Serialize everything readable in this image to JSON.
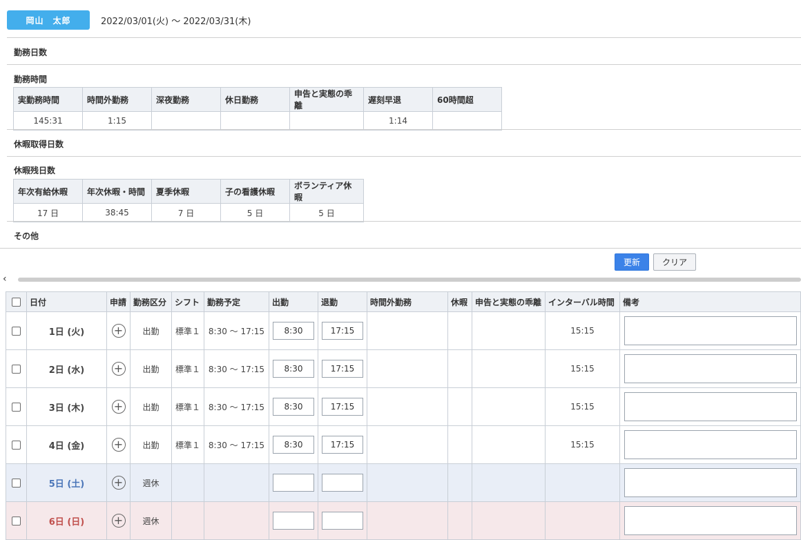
{
  "header": {
    "employee_name": "岡山　太郎",
    "period": "2022/03/01(火) ～ 2022/03/31(木)"
  },
  "sections": {
    "work_days": "勤務日数",
    "work_hours": "勤務時間",
    "leave_taken": "休暇取得日数",
    "leave_remaining": "休暇残日数",
    "other": "その他"
  },
  "work_hours_table": {
    "headers": [
      "実勤務時間",
      "時間外勤務",
      "深夜勤務",
      "休日勤務",
      "申告と実態の乖離",
      "遅刻早退",
      "60時間超"
    ],
    "values": [
      "145:31",
      "1:15",
      "",
      "",
      "",
      "1:14",
      ""
    ]
  },
  "leave_remaining_table": {
    "headers": [
      "年次有給休暇",
      "年次休暇・時間",
      "夏季休暇",
      "子の看護休暇",
      "ボランティア休暇"
    ],
    "values": [
      "17 日",
      "38:45",
      "7 日",
      "5 日",
      "5 日"
    ]
  },
  "buttons": {
    "update": "更新",
    "clear": "クリア"
  },
  "daily_table": {
    "headers": {
      "date": "日付",
      "application": "申請",
      "work_type": "勤務区分",
      "shift": "シフト",
      "planned": "勤務予定",
      "clock_in": "出勤",
      "clock_out": "退勤",
      "overtime": "時間外勤務",
      "leave": "休暇",
      "discrepancy": "申告と実態の乖離",
      "interval": "インターバル時間",
      "remarks": "備考"
    },
    "rows": [
      {
        "date": "1日 (火)",
        "work_type": "出勤",
        "shift": "標準１",
        "planned": "8:30 ～ 17:15",
        "clock_in": "8:30",
        "clock_out": "17:15",
        "interval": "15:15"
      },
      {
        "date": "2日 (水)",
        "work_type": "出勤",
        "shift": "標準１",
        "planned": "8:30 ～ 17:15",
        "clock_in": "8:30",
        "clock_out": "17:15",
        "interval": "15:15"
      },
      {
        "date": "3日 (木)",
        "work_type": "出勤",
        "shift": "標準１",
        "planned": "8:30 ～ 17:15",
        "clock_in": "8:30",
        "clock_out": "17:15",
        "interval": "15:15"
      },
      {
        "date": "4日 (金)",
        "work_type": "出勤",
        "shift": "標準１",
        "planned": "8:30 ～ 17:15",
        "clock_in": "8:30",
        "clock_out": "17:15",
        "interval": "15:15"
      },
      {
        "date": "5日 (土)",
        "work_type": "週休",
        "shift": "",
        "planned": "",
        "clock_in": "",
        "clock_out": "",
        "interval": ""
      },
      {
        "date": "6日 (日)",
        "work_type": "週休",
        "shift": "",
        "planned": "",
        "clock_in": "",
        "clock_out": "",
        "interval": ""
      }
    ]
  },
  "colors": {
    "name_badge": "#43aeec",
    "update_button": "#3b82e8",
    "saturday_row": "#e9eef7",
    "sunday_row": "#f6e8ea",
    "saturday_text": "#4a75b8",
    "sunday_text": "#c0504d"
  },
  "icons": {
    "apply": "circle-plus-icon",
    "scroll_left": "chevron-left-icon"
  }
}
